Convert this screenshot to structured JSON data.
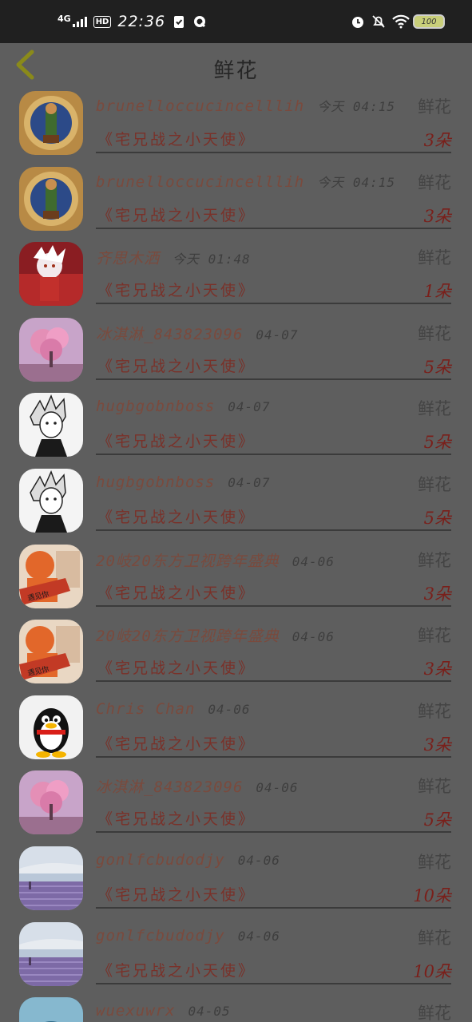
{
  "status_bar": {
    "network": "4G",
    "hd": "HD",
    "time": "22:36",
    "battery": "100",
    "icons": [
      "signal-icon",
      "checkmark-icon",
      "sync-icon",
      "alarm-icon",
      "bell-off-icon",
      "wifi-icon",
      "battery-icon"
    ]
  },
  "header": {
    "title": "鲜花",
    "back_icon": "chevron-left-icon"
  },
  "colors": {
    "background": "#5e5e5e",
    "status_bar": "#202020",
    "sender": "#7a4a3d",
    "book": "#7a3129",
    "quantity": "#7a1f1a",
    "back_icon": "#8a8a1a"
  },
  "records": [
    {
      "sender": "brunelloccucincelllih",
      "time": "今天 04:15",
      "gift": "鲜花",
      "book": "《宅兄战之小天使》",
      "quantity": "3朵",
      "avatar": "game-character-avatar"
    },
    {
      "sender": "brunelloccucincelllih",
      "time": "今天 04:15",
      "gift": "鲜花",
      "book": "《宅兄战之小天使》",
      "quantity": "3朵",
      "avatar": "game-character-avatar"
    },
    {
      "sender": "齐思木洒",
      "time": "今天 01:48",
      "gift": "鲜花",
      "book": "《宅兄战之小天使》",
      "quantity": "1朵",
      "avatar": "anime-red-avatar"
    },
    {
      "sender": "冰淇淋_843823096",
      "time": "04-07",
      "gift": "鲜花",
      "book": "《宅兄战之小天使》",
      "quantity": "5朵",
      "avatar": "pink-tree-avatar"
    },
    {
      "sender": "hugbgobnboss",
      "time": "04-07",
      "gift": "鲜花",
      "book": "《宅兄战之小天使》",
      "quantity": "5朵",
      "avatar": "manga-boy-avatar"
    },
    {
      "sender": "hugbgobnboss",
      "time": "04-07",
      "gift": "鲜花",
      "book": "《宅兄战之小天使》",
      "quantity": "5朵",
      "avatar": "manga-boy-avatar"
    },
    {
      "sender": "20岐20东方卫视跨年盛典",
      "time": "04-06",
      "gift": "鲜花",
      "book": "《宅兄战之小天使》",
      "quantity": "3朵",
      "avatar": "orange-hat-avatar"
    },
    {
      "sender": "20岐20东方卫视跨年盛典",
      "time": "04-06",
      "gift": "鲜花",
      "book": "《宅兄战之小天使》",
      "quantity": "3朵",
      "avatar": "orange-hat-avatar"
    },
    {
      "sender": "Chris Chan",
      "time": "04-06",
      "gift": "鲜花",
      "book": "《宅兄战之小天使》",
      "quantity": "3朵",
      "avatar": "penguin-avatar"
    },
    {
      "sender": "冰淇淋_843823096",
      "time": "04-06",
      "gift": "鲜花",
      "book": "《宅兄战之小天使》",
      "quantity": "5朵",
      "avatar": "pink-tree-avatar"
    },
    {
      "sender": "gonlfcbudodjy",
      "time": "04-06",
      "gift": "鲜花",
      "book": "《宅兄战之小天使》",
      "quantity": "10朵",
      "avatar": "lavender-field-avatar"
    },
    {
      "sender": "gonlfcbudodjy",
      "time": "04-06",
      "gift": "鲜花",
      "book": "《宅兄战之小天使》",
      "quantity": "10朵",
      "avatar": "lavender-field-avatar"
    },
    {
      "sender": "wuexuwrx",
      "time": "04-05",
      "gift": "鲜花",
      "book": "",
      "quantity": "",
      "avatar": "landscape-avatar"
    }
  ]
}
